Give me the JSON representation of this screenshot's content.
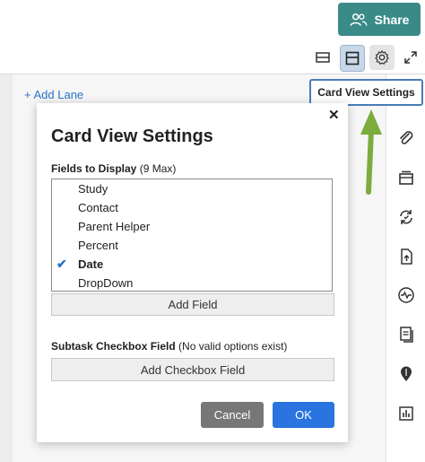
{
  "header": {
    "share_label": "Share",
    "share_color": "#3a8a88"
  },
  "view_icons": [
    "list-view-icon",
    "card-view-icon",
    "gear-icon",
    "expand-icon"
  ],
  "board": {
    "add_lane_label": "+ Add Lane"
  },
  "tooltip": {
    "text": "Card View Settings"
  },
  "modal": {
    "title": "Card View Settings",
    "close_glyph": "✕",
    "fields_label_bold": "Fields to Display",
    "fields_label_extra": " (9 Max)",
    "fields": [
      {
        "label": "Study",
        "selected": false
      },
      {
        "label": "Contact",
        "selected": false
      },
      {
        "label": "Parent Helper",
        "selected": false
      },
      {
        "label": "Percent",
        "selected": false
      },
      {
        "label": "Date",
        "selected": true
      },
      {
        "label": "DropDown",
        "selected": false
      }
    ],
    "add_field_label": "Add Field",
    "subtask_label_bold": "Subtask Checkbox Field",
    "subtask_label_extra": " (No valid options exist)",
    "add_checkbox_label": "Add Checkbox Field",
    "cancel_label": "Cancel",
    "ok_label": "OK",
    "ok_color": "#2a74e0"
  },
  "right_toolbar_icons": [
    "paperclip-icon",
    "wallet-icon",
    "sync-icon",
    "upload-file-icon",
    "activity-icon",
    "document-stack-icon",
    "location-pin-icon",
    "bar-chart-icon"
  ]
}
